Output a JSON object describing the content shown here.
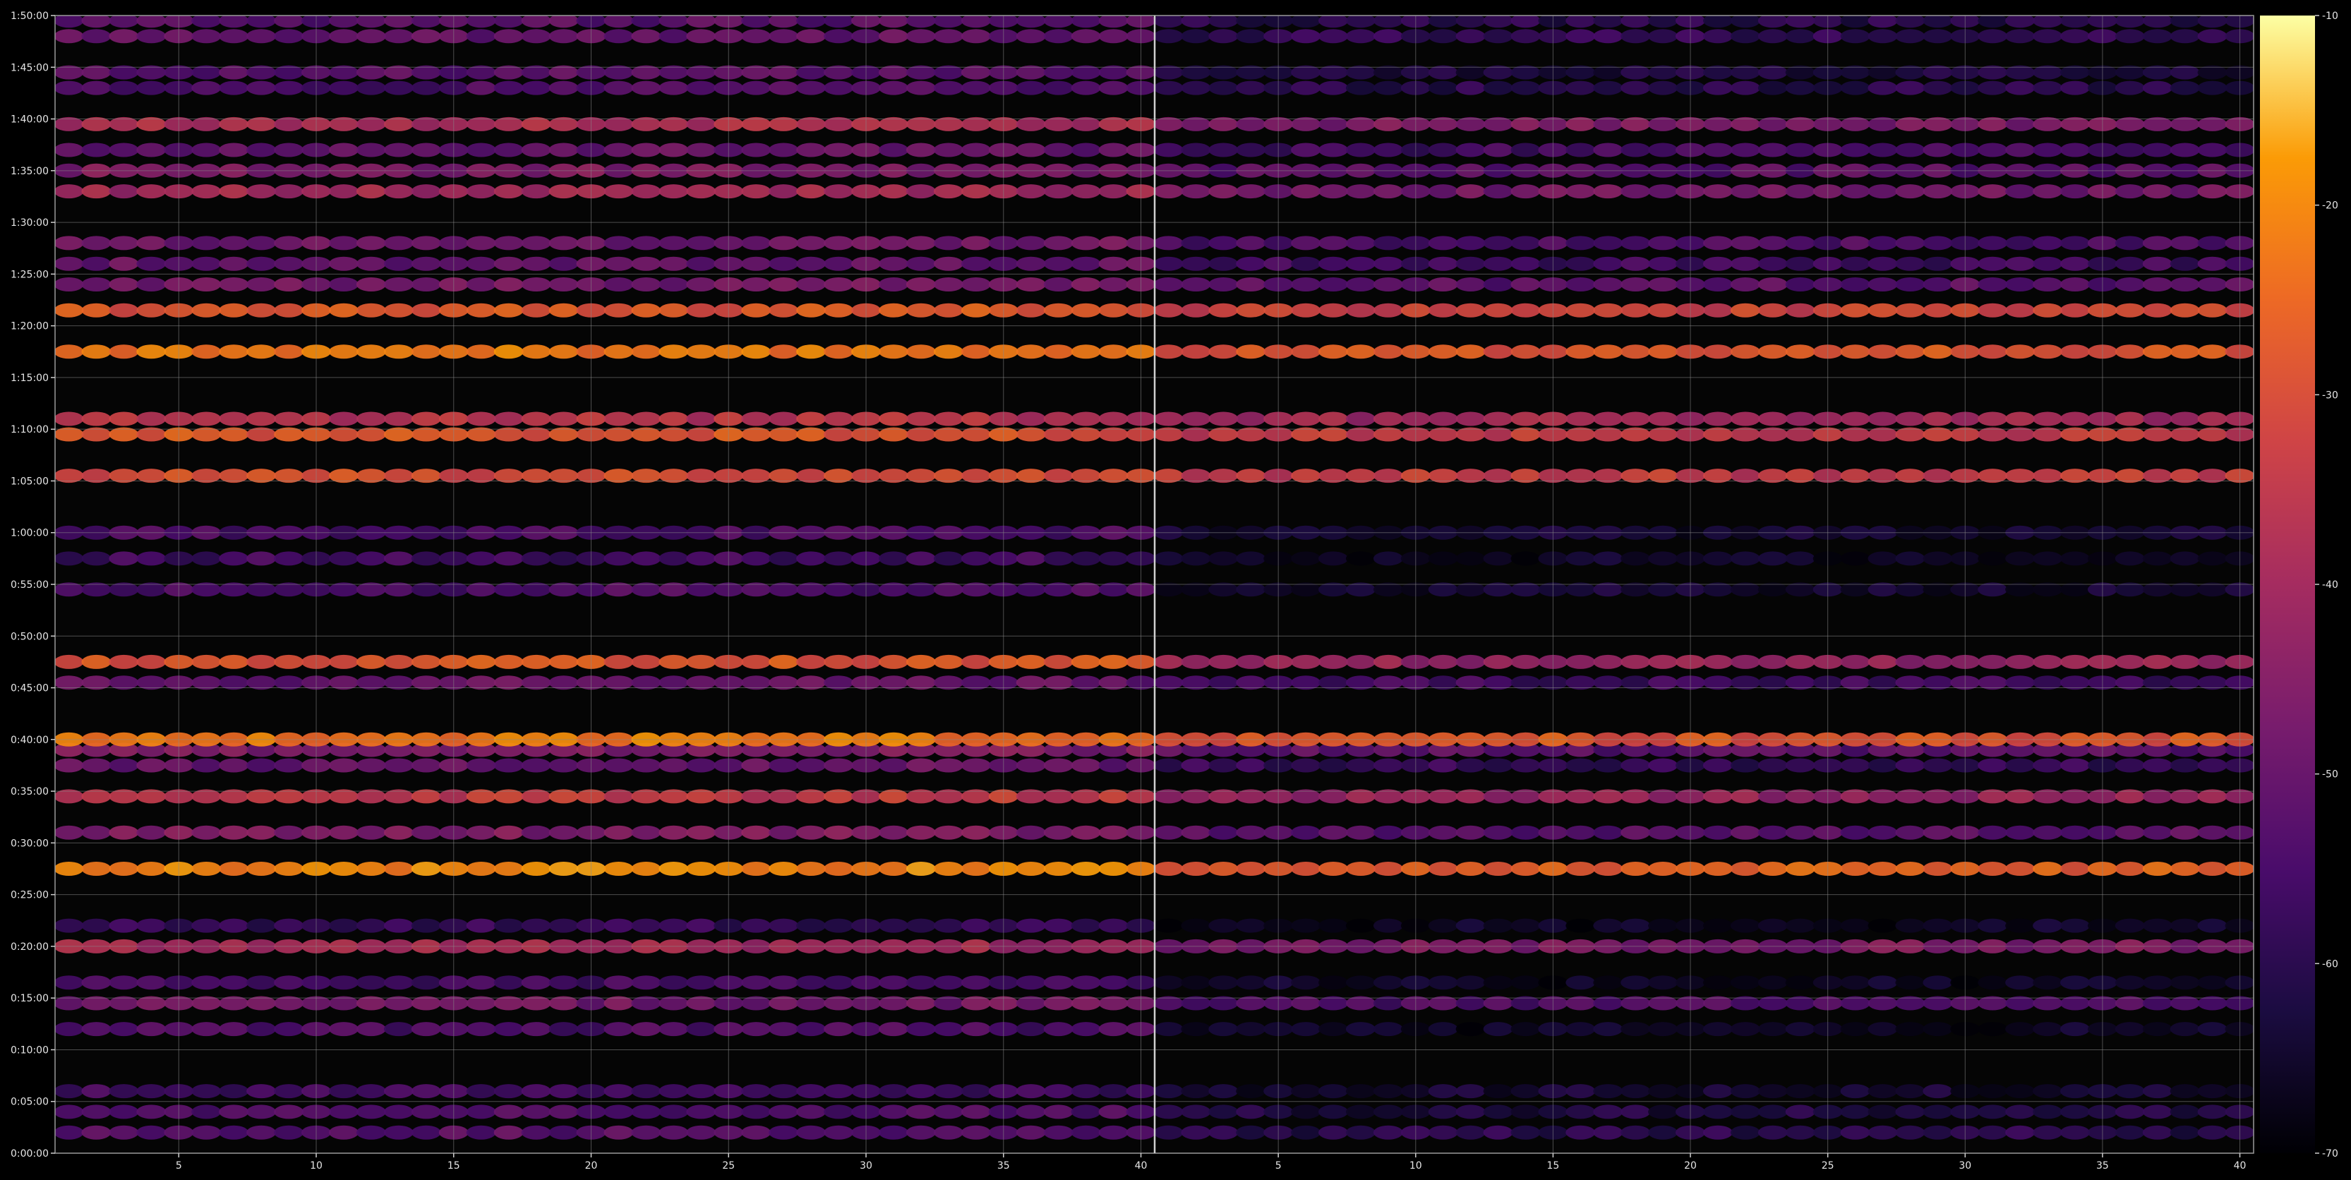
{
  "chart_data": {
    "type": "heatmap",
    "title": "",
    "xlabel": "",
    "ylabel": "",
    "colormap": "inferno",
    "background": "#000000",
    "grid": true,
    "panels": [
      {
        "name": "",
        "x_range": [
          1,
          40
        ],
        "x_ticks": [
          5,
          10,
          15,
          20,
          25,
          30,
          35,
          40
        ]
      },
      {
        "name": "",
        "x_range": [
          1,
          40
        ],
        "x_ticks": [
          5,
          10,
          15,
          20,
          25,
          30,
          35,
          40
        ]
      }
    ],
    "y_range_seconds": [
      0,
      6600
    ],
    "y_ticks": [
      "0:00:00",
      "0:05:00",
      "0:10:00",
      "0:15:00",
      "0:20:00",
      "0:25:00",
      "0:30:00",
      "0:35:00",
      "0:40:00",
      "0:45:00",
      "0:50:00",
      "0:55:00",
      "1:00:00",
      "1:05:00",
      "1:10:00",
      "1:15:00",
      "1:20:00",
      "1:25:00",
      "1:30:00",
      "1:35:00",
      "1:40:00",
      "1:45:00",
      "1:50:00"
    ],
    "colorbar": {
      "min": -70,
      "max": -10,
      "ticks": [
        "-10",
        "-20",
        "-30",
        "-40",
        "-50",
        "-60",
        "-70"
      ]
    },
    "bands": [
      {
        "t": "0:02:00",
        "left": -52,
        "right": -60
      },
      {
        "t": "0:04:00",
        "left": -54,
        "right": -62
      },
      {
        "t": "0:06:00",
        "left": -56,
        "right": -64
      },
      {
        "t": "0:12:00",
        "left": -54,
        "right": -66
      },
      {
        "t": "0:14:30",
        "left": -48,
        "right": -54
      },
      {
        "t": "0:16:30",
        "left": -56,
        "right": -66
      },
      {
        "t": "0:20:00",
        "left": -40,
        "right": -46
      },
      {
        "t": "0:22:00",
        "left": -58,
        "right": -66
      },
      {
        "t": "0:27:30",
        "left": -20,
        "right": -26
      },
      {
        "t": "0:31:00",
        "left": -46,
        "right": -52
      },
      {
        "t": "0:34:30",
        "left": -34,
        "right": -42
      },
      {
        "t": "0:37:30",
        "left": -50,
        "right": -58
      },
      {
        "t": "0:39:00",
        "left": -46,
        "right": -52
      },
      {
        "t": "0:40:00",
        "left": -22,
        "right": -28
      },
      {
        "t": "0:45:30",
        "left": -50,
        "right": -56
      },
      {
        "t": "0:47:30",
        "left": -28,
        "right": -42
      },
      {
        "t": "0:54:30",
        "left": -54,
        "right": -64
      },
      {
        "t": "0:57:30",
        "left": -56,
        "right": -66
      },
      {
        "t": "1:00:00",
        "left": -54,
        "right": -64
      },
      {
        "t": "1:05:30",
        "left": -30,
        "right": -34
      },
      {
        "t": "1:09:30",
        "left": -28,
        "right": -34
      },
      {
        "t": "1:11:00",
        "left": -36,
        "right": -40
      },
      {
        "t": "1:17:30",
        "left": -22,
        "right": -28
      },
      {
        "t": "1:21:30",
        "left": -28,
        "right": -32
      },
      {
        "t": "1:24:00",
        "left": -48,
        "right": -52
      },
      {
        "t": "1:26:00",
        "left": -50,
        "right": -56
      },
      {
        "t": "1:28:00",
        "left": -48,
        "right": -54
      },
      {
        "t": "1:33:00",
        "left": -40,
        "right": -48
      },
      {
        "t": "1:35:00",
        "left": -46,
        "right": -52
      },
      {
        "t": "1:37:00",
        "left": -50,
        "right": -56
      },
      {
        "t": "1:39:30",
        "left": -38,
        "right": -46
      },
      {
        "t": "1:43:00",
        "left": -54,
        "right": -60
      },
      {
        "t": "1:44:30",
        "left": -52,
        "right": -62
      },
      {
        "t": "1:48:00",
        "left": -50,
        "right": -58
      },
      {
        "t": "1:49:30",
        "left": -52,
        "right": -60
      }
    ]
  }
}
